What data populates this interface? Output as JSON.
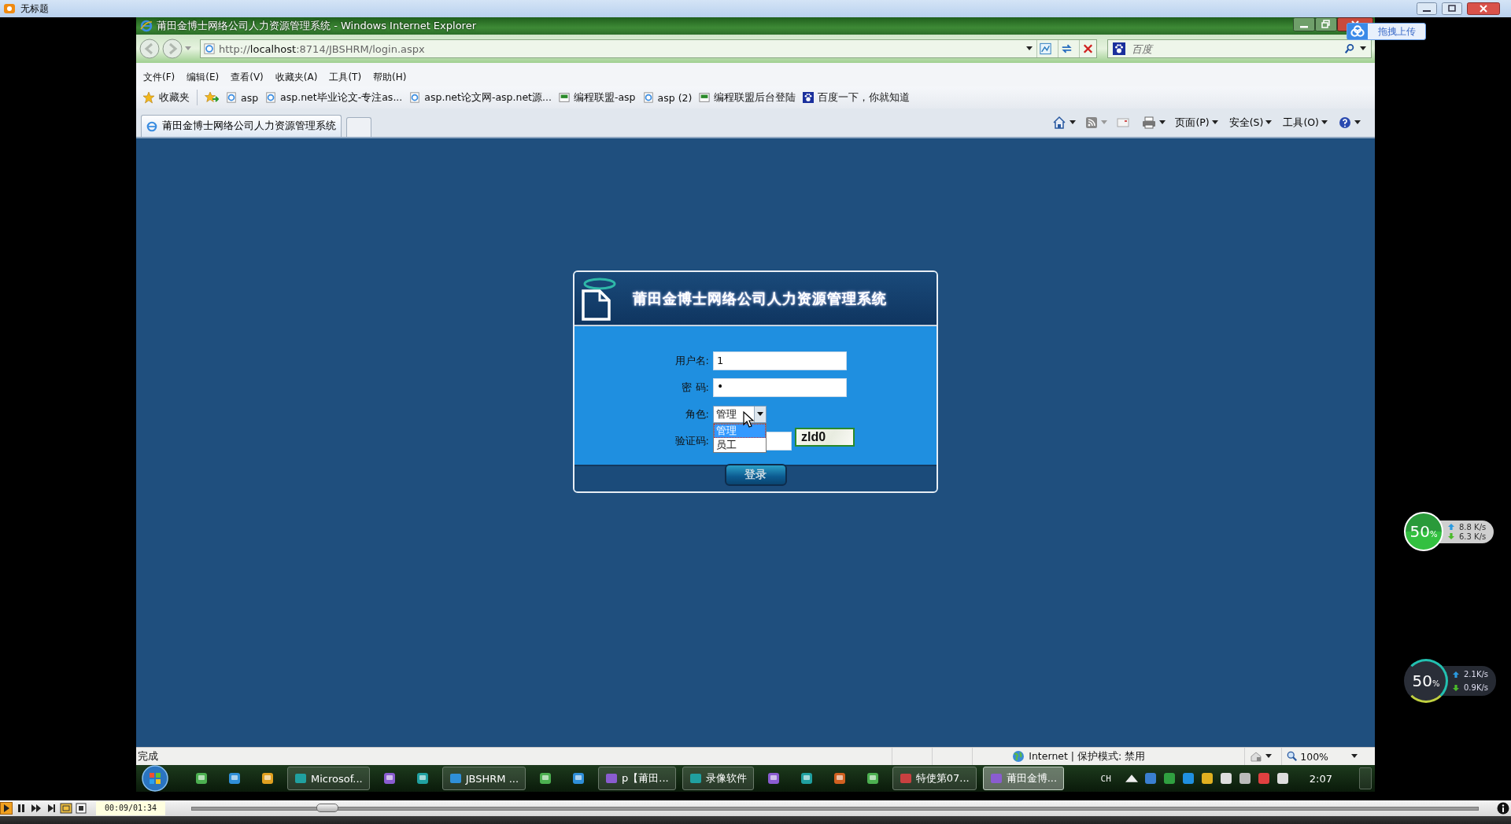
{
  "player": {
    "title": "无标题",
    "time": "00:09/01:34",
    "level": 0.105
  },
  "upload_button": {
    "label": "拖拽上传"
  },
  "browser": {
    "title": "莆田金博士网络公司人力资源管理系统 - Windows Internet Explorer",
    "address": "http://**localhost**:8714/JBSHRM/login.aspx",
    "search_placeholder": "百度",
    "menu": [
      "文件(F)",
      "编辑(E)",
      "查看(V)",
      "收藏夹(A)",
      "工具(T)",
      "帮助(H)"
    ],
    "favorites": "收藏夹",
    "bookmarks": [
      {
        "label": "asp",
        "kind": "page"
      },
      {
        "label": "asp.net毕业论文-专注as...",
        "kind": "page"
      },
      {
        "label": "asp.net论文网-asp.net源...",
        "kind": "page"
      },
      {
        "label": "编程联盟-asp",
        "kind": "site"
      },
      {
        "label": "asp (2)",
        "kind": "page"
      },
      {
        "label": "编程联盟后台登陆",
        "kind": "site"
      },
      {
        "label": "百度一下，你就知道",
        "kind": "paw"
      }
    ],
    "tabs": [
      {
        "label": "莆田金博士网络公司人力资源管理系统",
        "selected": true
      }
    ],
    "commands": [
      "页面(P)",
      "安全(S)",
      "工具(O)"
    ],
    "status": {
      "text": "完成",
      "zone": "Internet | 保护模式: 禁用",
      "zoom": "100%"
    }
  },
  "login": {
    "title": "莆田金博士网络公司人力资源管理系统",
    "username": {
      "label": "用户名:",
      "value": "1"
    },
    "password": {
      "label": "密 码:",
      "value": "•"
    },
    "role": {
      "label": "角色:",
      "value": "管理",
      "options": [
        {
          "label": "管理",
          "selected": true
        },
        {
          "label": "员工",
          "selected": false
        }
      ]
    },
    "captcha": {
      "label": "验证码:",
      "code": "zld0"
    },
    "button": "登录"
  },
  "taskbar": {
    "items": [
      {
        "kind": "icon"
      },
      {
        "kind": "icon"
      },
      {
        "kind": "icon"
      },
      {
        "kind": "button",
        "label": "Microsof...",
        "selected": false
      },
      {
        "kind": "icon"
      },
      {
        "kind": "icon"
      },
      {
        "kind": "button",
        "label": "JBSHRM ...",
        "selected": false
      },
      {
        "kind": "icon"
      },
      {
        "kind": "icon"
      },
      {
        "kind": "button",
        "label": "p【莆田...",
        "selected": false
      },
      {
        "kind": "button",
        "label": "录像软件",
        "selected": false
      },
      {
        "kind": "icon"
      },
      {
        "kind": "icon"
      },
      {
        "kind": "icon"
      },
      {
        "kind": "icon"
      },
      {
        "kind": "button",
        "label": "特使第07...",
        "selected": false
      },
      {
        "kind": "button",
        "label": "莆田金博...",
        "selected": true
      }
    ],
    "language": "CH",
    "clock": "2:07"
  },
  "net_monitors": [
    {
      "kind": "green",
      "value": "50",
      "unit": "%",
      "up": "8.8 K/s",
      "down": "6.3 K/s"
    },
    {
      "kind": "dark",
      "value": "50",
      "unit": "%",
      "up": "2.1K/s",
      "down": "0.9K/s"
    }
  ]
}
